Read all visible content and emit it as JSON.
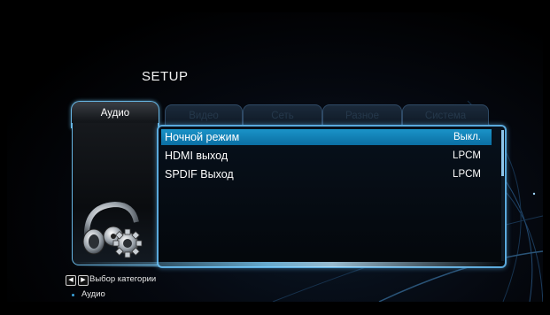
{
  "header": {
    "title": "SETUP"
  },
  "tabs": [
    {
      "label": "Аудио",
      "active": true
    },
    {
      "label": "Видео",
      "active": false
    },
    {
      "label": "Сеть",
      "active": false
    },
    {
      "label": "Разное",
      "active": false
    },
    {
      "label": "Система",
      "active": false
    }
  ],
  "settings": [
    {
      "label": "Ночной режим",
      "value": "Выкл.",
      "selected": true
    },
    {
      "label": "HDMI выход",
      "value": "LPCM",
      "selected": false
    },
    {
      "label": "SPDIF Выход",
      "value": "LPCM",
      "selected": false
    }
  ],
  "left_panel": {
    "icon": "headphones-gear-icon"
  },
  "help": {
    "nav_hint": "Выбор категории",
    "current_category": "Аудио",
    "keys": [
      "arrow-left-key-icon",
      "arrow-right-key-icon"
    ]
  },
  "colors": {
    "accent": "#1a93c8",
    "frame": "#5aa9dc",
    "background": "#000000"
  }
}
